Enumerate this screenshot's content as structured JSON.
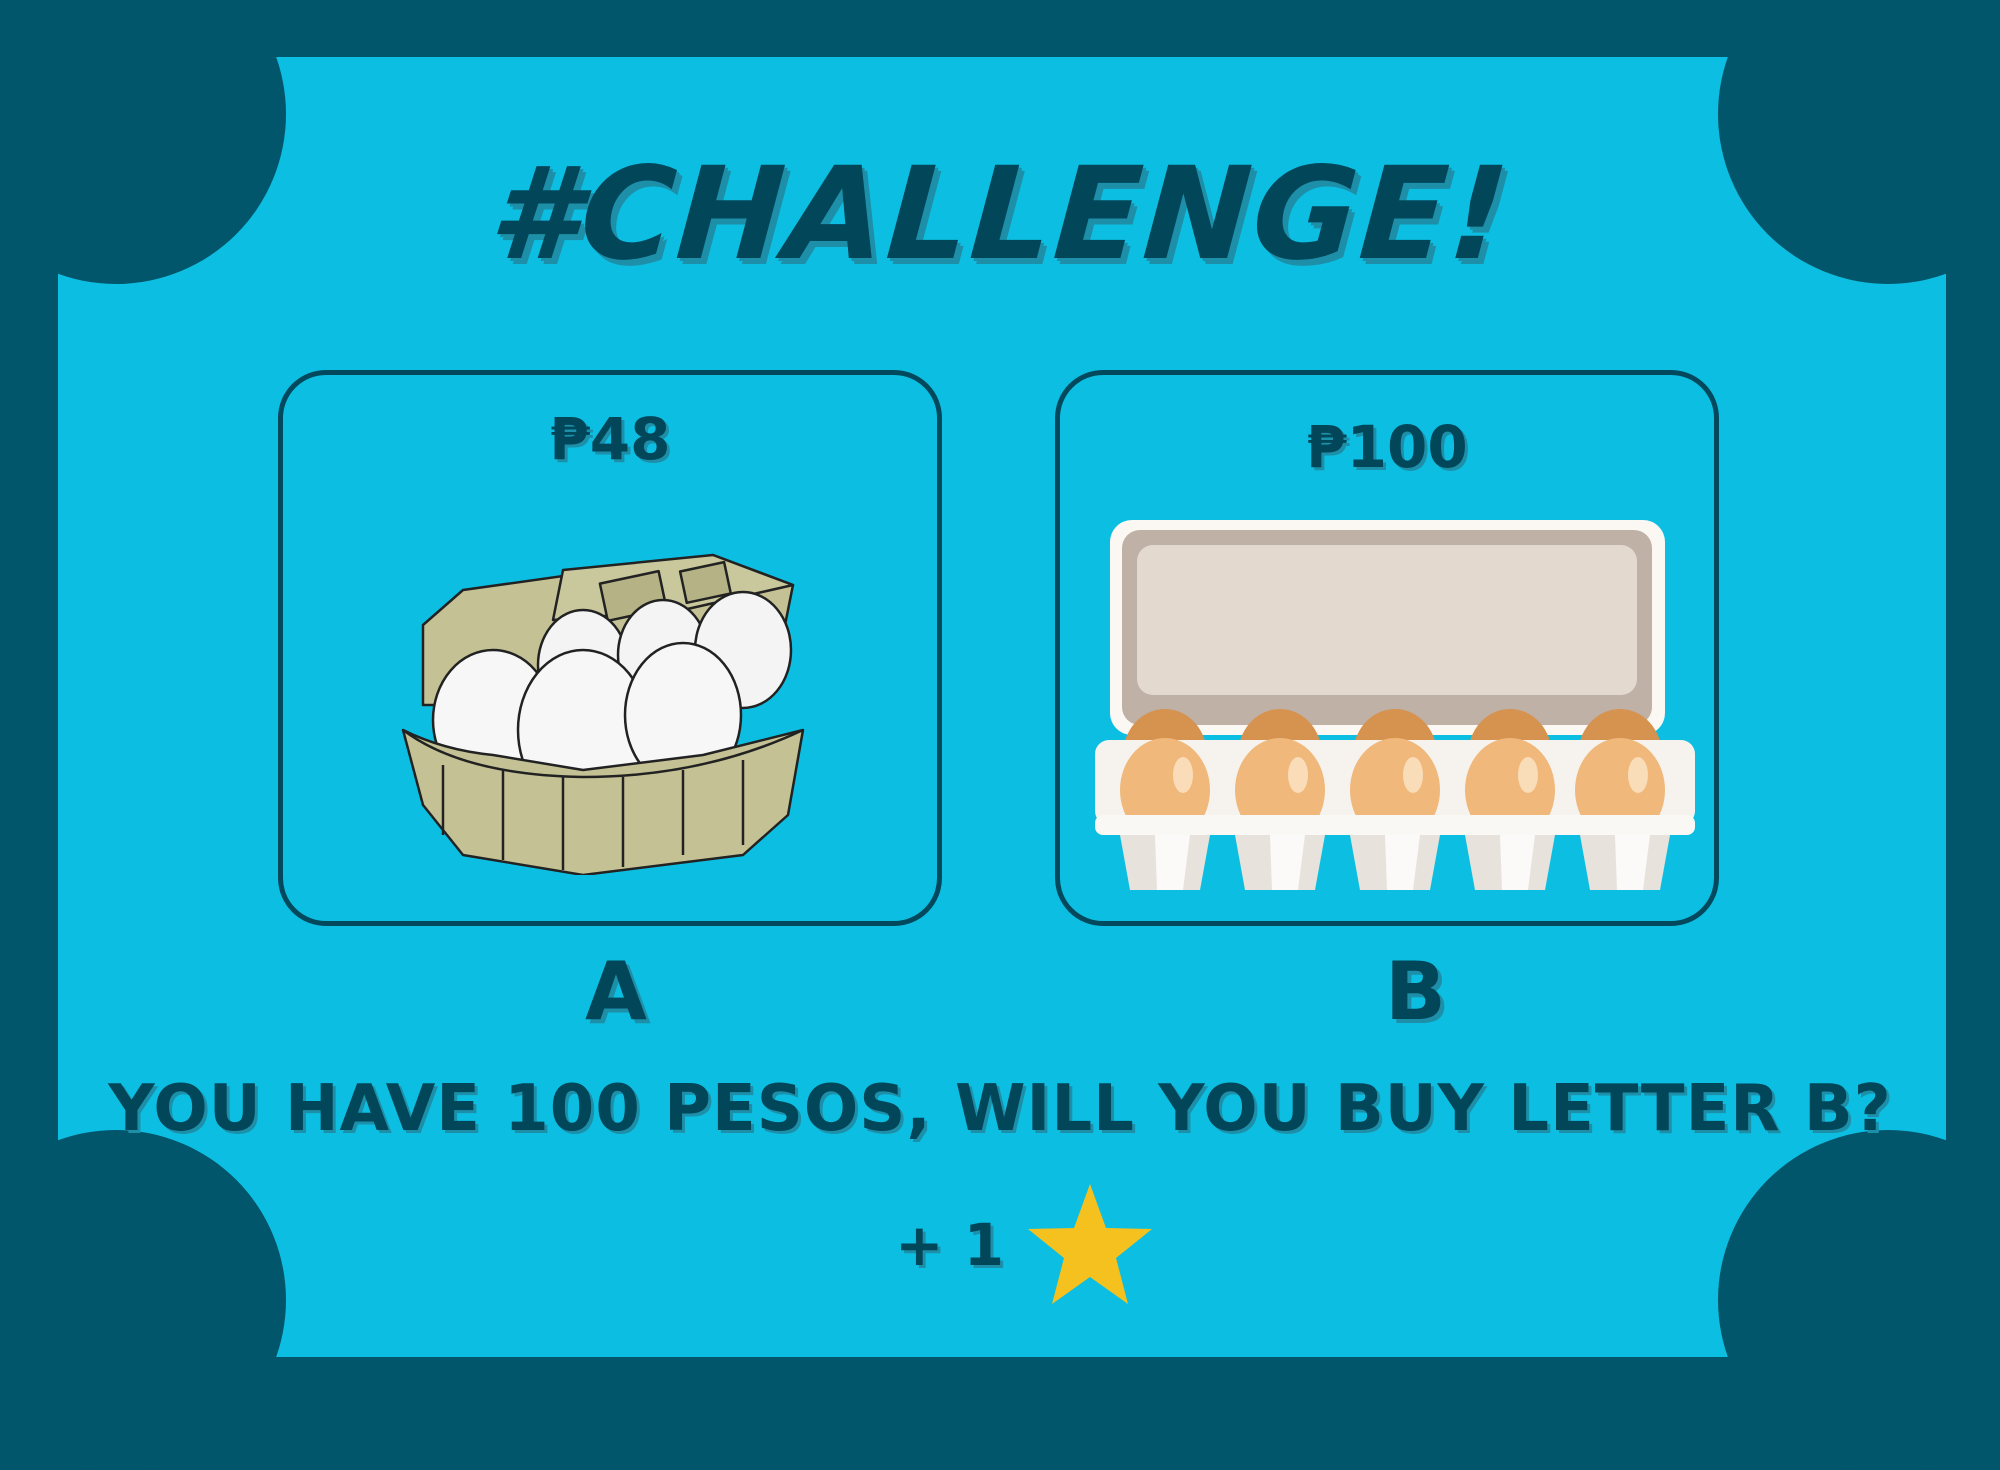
{
  "title": "#CHALLENGE!",
  "options": [
    {
      "price": "₱48",
      "letter": "A",
      "image": "egg-carton-6-white-icon"
    },
    {
      "price": "₱100",
      "letter": "B",
      "image": "egg-carton-10-brown-icon"
    }
  ],
  "question": "YOU HAVE 100 PESOS, WILL YOU BUY LETTER B?",
  "reward": {
    "text": "+ 1",
    "icon": "star-icon"
  },
  "colors": {
    "background": "#01566b",
    "card": "#0cbfe2",
    "text": "#02465a",
    "star": "#f5c11f"
  }
}
